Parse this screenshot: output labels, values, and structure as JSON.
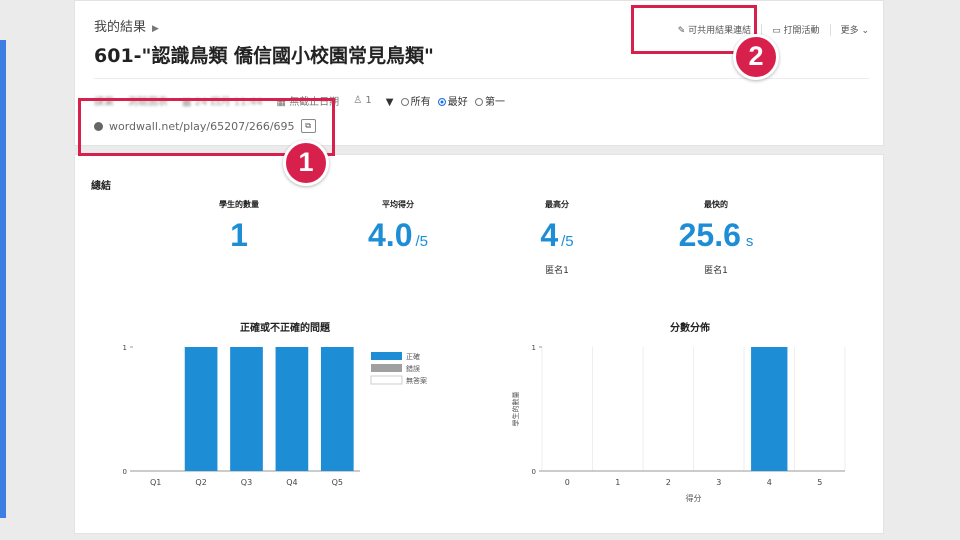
{
  "header": {
    "breadcrumb": "我的結果",
    "title": "601-\"認識鳥類 僑信國小校園常見鳥類\"",
    "actions": {
      "share": "可共用結果連結",
      "print": "打開活動",
      "more": "更多"
    }
  },
  "meta": {
    "item1": "課業",
    "item2": "測驗圖表",
    "date": "24 四月 11:44",
    "deadline": "無截止日期",
    "count": "1",
    "filter": {
      "all": "所有",
      "best": "最好",
      "first": "第一"
    }
  },
  "url": "wordwall.net/play/65207/266/695",
  "callouts": {
    "one": "1",
    "two": "2"
  },
  "summary": {
    "heading": "總結",
    "students": {
      "label": "學生的數量",
      "value": "1"
    },
    "average": {
      "label": "平均得分",
      "value": "4.0",
      "unit": "/5"
    },
    "highest": {
      "label": "最高分",
      "value": "4",
      "unit": "/5",
      "who": "匿名1"
    },
    "fastest": {
      "label": "最快的",
      "value": "25.6",
      "unit": "s",
      "who": "匿名1"
    }
  },
  "chart_data": [
    {
      "type": "bar",
      "title": "正確或不正確的問題",
      "categories": [
        "Q1",
        "Q2",
        "Q3",
        "Q4",
        "Q5"
      ],
      "series": [
        {
          "name": "正確",
          "values": [
            0,
            1,
            1,
            1,
            1
          ],
          "color": "#1d8dd6"
        },
        {
          "name": "錯誤",
          "values": [
            0,
            0,
            0,
            0,
            0
          ],
          "color": "#a0a0a0"
        },
        {
          "name": "無答案",
          "values": [
            0,
            0,
            0,
            0,
            0
          ],
          "color": "#ffffff"
        }
      ],
      "ylim": [
        0,
        1
      ],
      "yticks": [
        "0",
        "1"
      ],
      "legend": "right"
    },
    {
      "type": "bar",
      "title": "分數分佈",
      "categories": [
        "0",
        "1",
        "2",
        "3",
        "4",
        "5"
      ],
      "values": [
        0,
        0,
        0,
        0,
        1,
        0
      ],
      "xlabel": "得分",
      "ylabel": "學生的數量",
      "ylim": [
        0,
        1
      ],
      "yticks": [
        "0",
        "1"
      ],
      "color": "#1d8dd6"
    }
  ]
}
